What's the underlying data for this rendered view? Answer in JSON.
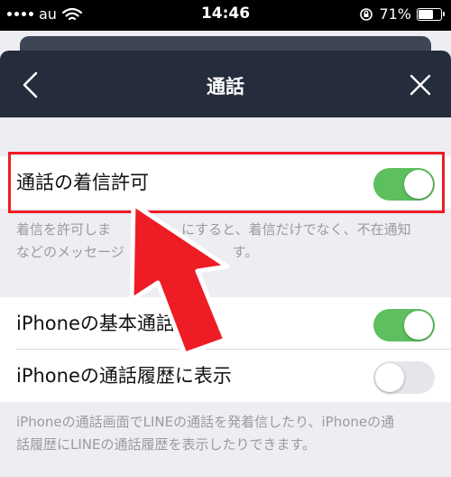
{
  "status": {
    "carrier": "au",
    "time": "14:46",
    "battery_pct": "71%",
    "battery_level": 0.71
  },
  "header": {
    "title": "通話",
    "back_icon": "chevron-left-icon",
    "close_icon": "close-icon"
  },
  "settings": [
    {
      "label": "通話の着信許可",
      "enabled": true
    }
  ],
  "desc1": {
    "line1": "着信を許可しま",
    "line1b": "にすると、着信だけでなく、不在通知",
    "line2": "などのメッセージ",
    "line2b": "す。"
  },
  "iphone_settings": [
    {
      "label": "iPhoneの基本通話",
      "enabled": true
    },
    {
      "label": "iPhoneの通話履歴に表示",
      "enabled": false
    }
  ],
  "desc2": {
    "line1": "iPhoneの通話画面でLINEの通話を発着信したり、iPhoneの通",
    "line2": "話履歴にLINEの通話履歴を表示したりできます。"
  },
  "colors": {
    "header_bg": "#252d3c",
    "toggle_on": "#5ebf5e",
    "toggle_off": "#e6e6ea",
    "highlight": "#ee1c25",
    "page_bg": "#ededf2"
  }
}
